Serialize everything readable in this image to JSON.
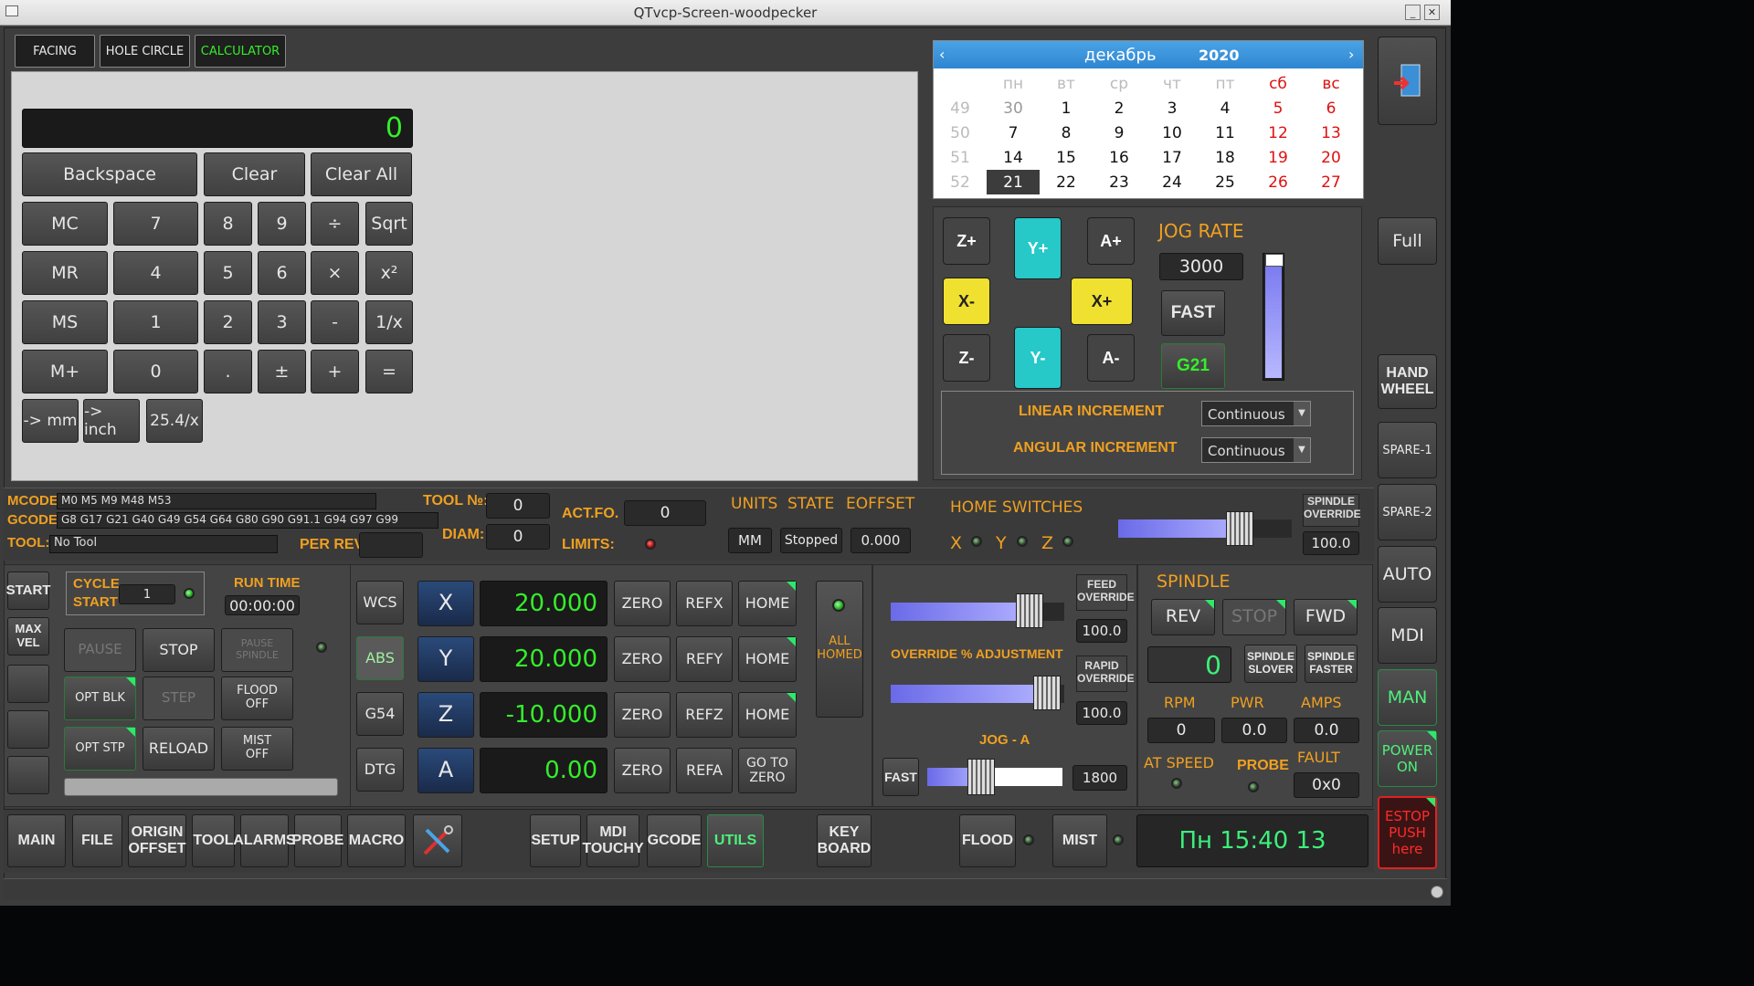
{
  "window": {
    "title": "QTvcp-Screen-woodpecker"
  },
  "tabs": [
    "FACING",
    "HOLE CIRCLE",
    "CALCULATOR"
  ],
  "calc": {
    "display": "0",
    "row0": [
      "Backspace",
      "Clear",
      "Clear All"
    ],
    "rows": [
      [
        "MC",
        "7",
        "8",
        "9",
        "÷",
        "Sqrt"
      ],
      [
        "MR",
        "4",
        "5",
        "6",
        "×",
        "x²"
      ],
      [
        "MS",
        "1",
        "2",
        "3",
        "-",
        "1/x"
      ],
      [
        "M+",
        "0",
        ".",
        "±",
        "+",
        "="
      ]
    ],
    "row5": [
      "-> mm",
      "-> inch",
      "25.4/x"
    ]
  },
  "calendar": {
    "month": "декабрь",
    "year": "2020",
    "days": [
      "пн",
      "вт",
      "ср",
      "чт",
      "пт",
      "сб",
      "вс"
    ],
    "weeks": [
      {
        "wk": "49",
        "d": [
          "30",
          "1",
          "2",
          "3",
          "4",
          "5",
          "6"
        ]
      },
      {
        "wk": "50",
        "d": [
          "7",
          "8",
          "9",
          "10",
          "11",
          "12",
          "13"
        ]
      },
      {
        "wk": "51",
        "d": [
          "14",
          "15",
          "16",
          "17",
          "18",
          "19",
          "20"
        ]
      },
      {
        "wk": "52",
        "d": [
          "21",
          "22",
          "23",
          "24",
          "25",
          "26",
          "27"
        ]
      }
    ]
  },
  "jog": {
    "rate_label": "JOG RATE",
    "rate": "3000",
    "fast": "FAST",
    "units": "G21",
    "linear_label": "LINEAR INCREMENT",
    "angular_label": "ANGULAR INCREMENT",
    "linear_value": "Continuous",
    "angular_value": "Continuous",
    "buttons": {
      "zp": "Z+",
      "yp": "Y+",
      "ap": "A+",
      "xm": "X-",
      "xp": "X+",
      "zm": "Z-",
      "ym": "Y-",
      "am": "A-"
    },
    "rate_fraction": 0.93
  },
  "right_bar": {
    "exit": "exit-icon",
    "full": "Full",
    "handwheel": "HAND\nWHEEL",
    "spare1": "SPARE-1",
    "spare2": "SPARE-2",
    "auto": "AUTO",
    "mdi": "MDI",
    "man": "MAN",
    "power": "POWER\nON",
    "estop": "ESTOP\nPUSH\nhere"
  },
  "status": {
    "mcodes_label": "MCODES",
    "mcodes": "M0 M5 M9 M48 M53",
    "gcodes_label": "GCODES",
    "gcodes": "G8 G17 G21 G40 G49 G54 G64 G80 G90 G91.1 G94 G97 G99",
    "tool_label": "TOOL:",
    "tool": "No Tool",
    "toolno_label": "TOOL №:",
    "toolno": "0",
    "diam_label": "DIAM:",
    "diam": "0",
    "perrev_label": "PER REV:",
    "perrev": "",
    "actfo_label": "ACT.FO.",
    "actfo": "0",
    "limits_label": "LIMITS:",
    "units_label": "UNITS",
    "state_label": "STATE",
    "eoffset_label": "EOFFSET",
    "units": "MM",
    "state": "Stopped",
    "eoffset": "0.000",
    "home_label": "HOME SWITCHES",
    "home_axes": [
      "X",
      "Y",
      "Z"
    ],
    "spindle_ovr_label": "SPINDLE\nOVERRIDE",
    "spindle_ovr": "100.0"
  },
  "program": {
    "start": "START",
    "maxvel": "MAX\nVEL",
    "cycle": "CYCLE\nSTART",
    "cycle_count": "1",
    "runtime_label": "RUN TIME",
    "runtime": "00:00:00",
    "pause": "PAUSE",
    "stop": "STOP",
    "pause_spindle": "PAUSE\nSPINDLE",
    "optblk": "OPT BLK",
    "step": "STEP",
    "flood": "FLOOD\nOFF",
    "optstp": "OPT STP",
    "reload": "RELOAD",
    "mist": "MIST\nOFF"
  },
  "dro": {
    "modes": [
      "WCS",
      "ABS",
      "G54",
      "DTG"
    ],
    "axes": [
      {
        "n": "X",
        "v": "20.000",
        "r": "REFX",
        "h": "HOME"
      },
      {
        "n": "Y",
        "v": "20.000",
        "r": "REFY",
        "h": "HOME"
      },
      {
        "n": "Z",
        "v": "-10.000",
        "r": "REFZ",
        "h": "HOME"
      },
      {
        "n": "A",
        "v": "0.00",
        "r": "REFA",
        "h": "GO TO\nZERO"
      }
    ],
    "zero": "ZERO",
    "allhomed": "ALL\nHOMED"
  },
  "override": {
    "feed_label": "FEED\nOVERRIDE",
    "feed": "100.0",
    "adj_label": "OVERRIDE % ADJUSTMENT",
    "rapid_label": "RAPID\nOVERRIDE",
    "rapid": "100.0",
    "joga_label": "JOG - A",
    "fast": "FAST",
    "joga": "1800",
    "feed_fraction": 0.8,
    "rapid_fraction": 0.9,
    "joga_fraction": 0.4,
    "spindle_fraction": 0.7
  },
  "spindle": {
    "title": "SPINDLE",
    "rev": "REV",
    "stop": "STOP",
    "fwd": "FWD",
    "speed": "0",
    "slower": "SPINDLE\nSLOVER",
    "faster": "SPINDLE\nFASTER",
    "rpm_label": "RPM",
    "pwr_label": "PWR",
    "amps_label": "AMPS",
    "rpm": "0",
    "pwr": "0.0",
    "amps": "0.0",
    "atspeed": "AT SPEED",
    "probe": "PROBE",
    "fault_label": "FAULT",
    "fault": "0x0"
  },
  "bottom": {
    "tabs": [
      "MAIN",
      "FILE",
      "ORIGIN\nOFFSET",
      "TOOL",
      "ALARMS",
      "PROBE",
      "MACRO"
    ],
    "tabs2": [
      "SETUP",
      "MDI\nTOUCHY",
      "GCODE",
      "UTILS"
    ],
    "keyboard": "KEY\nBOARD",
    "flood": "FLOOD",
    "mist": "MIST",
    "clock": "Пн  15:40  13"
  },
  "colors": {
    "accent_orange": "#f0a020",
    "lcd_green": "#34ee2a",
    "jog_cyan": "#26c8c8",
    "jog_yellow": "#f0e030"
  }
}
